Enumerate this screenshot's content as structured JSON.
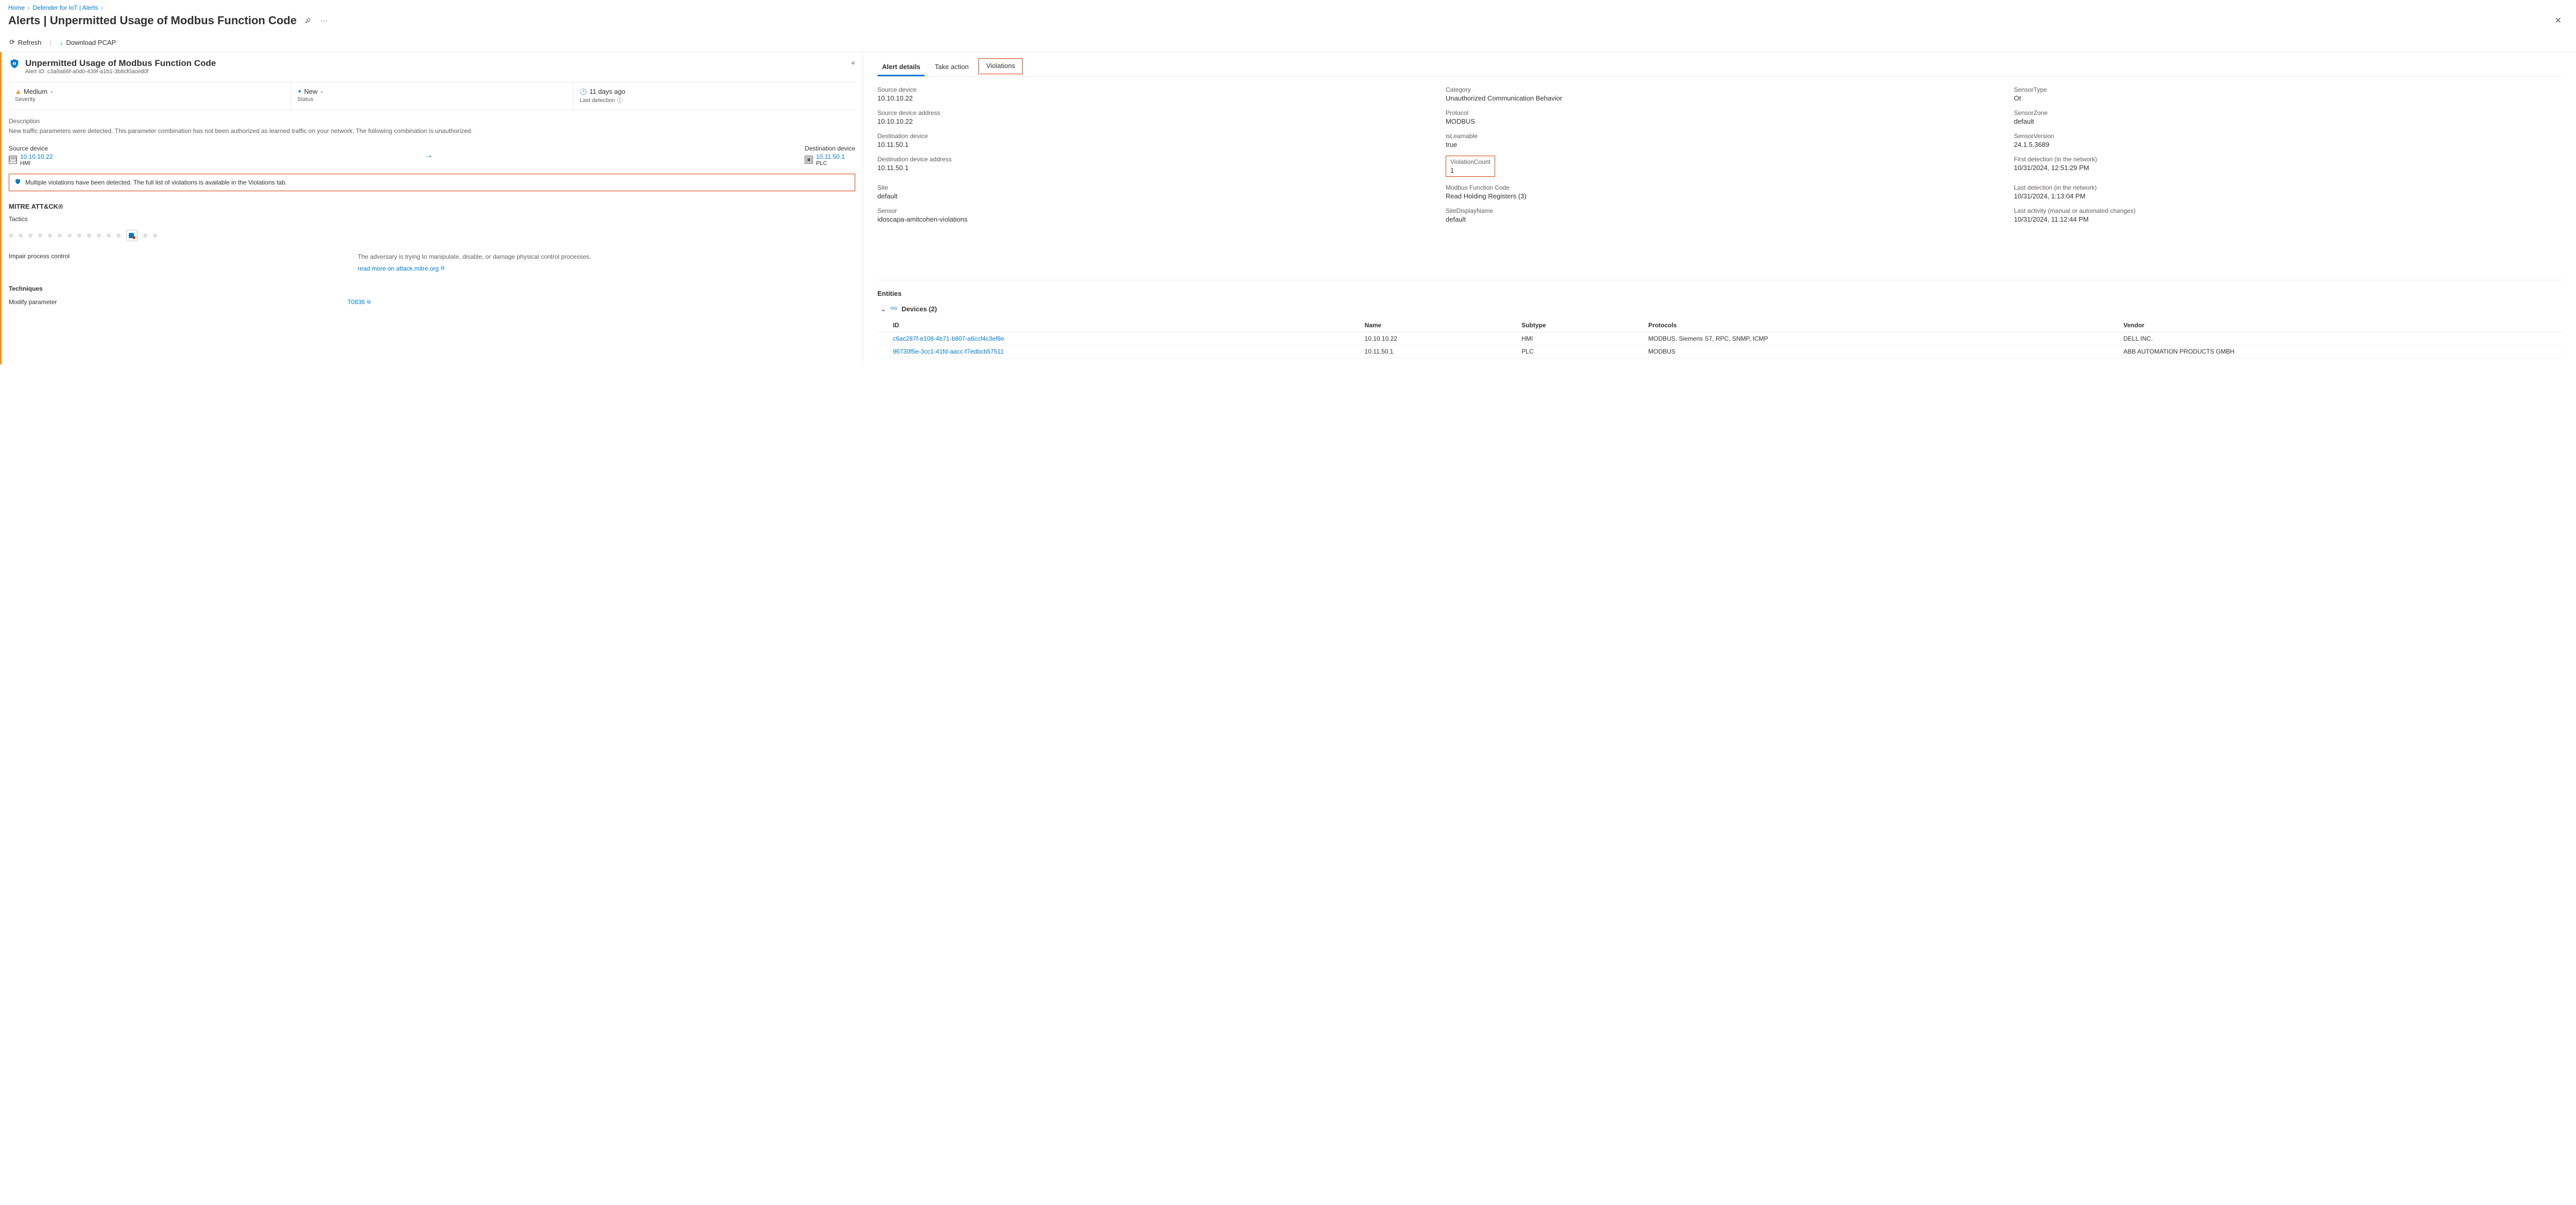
{
  "breadcrumbs": {
    "home": "Home",
    "defender": "Defender for IoT | Alerts",
    "sep": "›"
  },
  "page_title": "Alerts | Unpermitted Usage of Modbus Function Code",
  "toolbar": {
    "refresh": "Refresh",
    "download": "Download PCAP"
  },
  "alert": {
    "title": "Unpermitted Usage of Modbus Function Code",
    "id_label": "Alert ID: c3a9a66f-a0d0-439f-a1b1-3b8cf0aced0f",
    "severity_value": "Medium",
    "severity_label": "Severity",
    "status_value": "New",
    "status_label": "Status",
    "detection_value": "11 days ago",
    "detection_label": "Last detection",
    "desc_label": "Description",
    "desc_text": "New traffic parameters were detected. This parameter combination has not been authorized as learned traffic on your network. The following combination is unauthorized.",
    "source_label": "Source device",
    "source_ip": "10.10.10.22",
    "source_type": "HMI",
    "dest_label": "Destination device",
    "dest_ip": "10.11.50.1",
    "dest_type": "PLC",
    "notice": "Multiple violations have been detected. The full list of violations is available in the Violations tab."
  },
  "mitre": {
    "title": "MITRE ATT&CK®",
    "tactics_label": "Tactics",
    "impair": "Impair process control",
    "adversary": "The adversary is trying to manipulate, disable, or damage physical control processes.",
    "read_more": "read more on attack.mitre.org",
    "techniques_label": "Techniques",
    "tech_name": "Modify parameter",
    "tech_id": "T0836"
  },
  "tabs": {
    "details": "Alert details",
    "action": "Take action",
    "violations": "Violations"
  },
  "details": {
    "c0": [
      {
        "label": "Source device",
        "value": "10.10.10.22"
      },
      {
        "label": "Source device address",
        "value": "10.10.10.22"
      },
      {
        "label": "Destination device",
        "value": "10.11.50.1"
      },
      {
        "label": "Destination device address",
        "value": "10.11.50.1"
      },
      {
        "label": "Site",
        "value": "default"
      },
      {
        "label": "Sensor",
        "value": "idoscapa-amitcohen-violations"
      }
    ],
    "c1": [
      {
        "label": "Category",
        "value": "Unauthorized Communication Behavior"
      },
      {
        "label": "Protocol",
        "value": "MODBUS"
      },
      {
        "label": "isLearnable",
        "value": "true"
      },
      {
        "label": "ViolationCount",
        "value": "1",
        "boxed": true
      },
      {
        "label": "Modbus Function Code",
        "value": "Read Holding Registers (3)"
      },
      {
        "label": "SiteDisplayName",
        "value": "default"
      }
    ],
    "c2": [
      {
        "label": "SensorType",
        "value": "Ot"
      },
      {
        "label": "SensorZone",
        "value": "default"
      },
      {
        "label": "SensorVersion",
        "value": "24.1.5.3689"
      },
      {
        "label": "First detection (in the network)",
        "value": "10/31/2024, 12:51:29 PM"
      },
      {
        "label": "Last detection (in the network)",
        "value": "10/31/2024, 1:13:04 PM"
      },
      {
        "label": "Last activity (manual or automated changes)",
        "value": "10/31/2024, 11:12:44 PM"
      }
    ]
  },
  "entities": {
    "title": "Entities",
    "group": "Devices (2)",
    "headers": {
      "id": "ID",
      "name": "Name",
      "subtype": "Subtype",
      "protocols": "Protocols",
      "vendor": "Vendor"
    },
    "rows": [
      {
        "id": "c6ac287f-e108-4b71-b807-a6ccf4c3ef8e",
        "name": "10.10.10.22",
        "subtype": "HMI",
        "protocols": "MODBUS, Siemens S7, RPC, SNMP, ICMP",
        "vendor": "DELL INC."
      },
      {
        "id": "96730f5e-3cc1-41fd-aacc-f7edbcb57511",
        "name": "10.11.50.1",
        "subtype": "PLC",
        "protocols": "MODBUS",
        "vendor": "ABB AUTOMATION PRODUCTS GMBH"
      }
    ]
  }
}
